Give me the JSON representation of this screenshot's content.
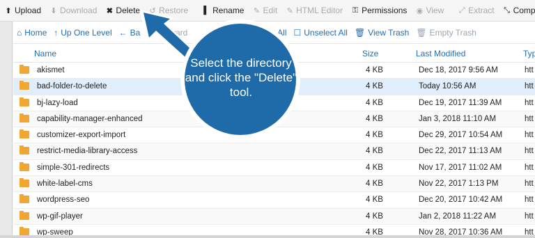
{
  "toolbar": {
    "items": [
      {
        "label": "Upload",
        "icon": "upload-icon",
        "glyph": "⭳",
        "disabled": false
      },
      {
        "label": "Download",
        "icon": "download-icon",
        "glyph": "⭳",
        "disabled": true
      },
      {
        "label": "Delete",
        "icon": "delete-icon",
        "glyph": "✖",
        "disabled": false
      },
      {
        "label": "Restore",
        "icon": "restore-icon",
        "glyph": "↺",
        "disabled": true
      },
      {
        "label": "Rename",
        "icon": "rename-icon",
        "glyph": "▌",
        "disabled": false
      },
      {
        "label": "Edit",
        "icon": "edit-icon",
        "glyph": "✎",
        "disabled": true
      },
      {
        "label": "HTML Editor",
        "icon": "html-editor-icon",
        "glyph": "✎",
        "disabled": true
      },
      {
        "label": "Permissions",
        "icon": "permissions-key-icon",
        "glyph": "⚿",
        "disabled": false
      },
      {
        "label": "View",
        "icon": "view-eye-icon",
        "glyph": "◉",
        "disabled": true
      },
      {
        "label": "Extract",
        "icon": "extract-icon",
        "glyph": "⤢",
        "disabled": true
      },
      {
        "label": "Compr",
        "icon": "compress-icon",
        "glyph": "⤡",
        "disabled": false
      }
    ]
  },
  "nav": {
    "home": "Home",
    "up_one_level": "Up One Level",
    "back": "Ba",
    "forward": "Forward",
    "select_all": "Select All",
    "unselect_all": "Unselect All",
    "view_trash": "View Trash",
    "empty_trash": "Empty Trash"
  },
  "table": {
    "headers": {
      "name": "Name",
      "size": "Size",
      "last_modified": "Last Modified",
      "type": "Typ"
    },
    "rows": [
      {
        "name": "akismet",
        "size": "4 KB",
        "modified": "Dec 18, 2017 9:56 AM",
        "type": "htt"
      },
      {
        "name": "bad-folder-to-delete",
        "size": "4 KB",
        "modified": "Today 10:56 AM",
        "type": "htt"
      },
      {
        "name": "bj-lazy-load",
        "size": "4 KB",
        "modified": "Dec 19, 2017 11:39 AM",
        "type": "htt"
      },
      {
        "name": "capability-manager-enhanced",
        "size": "4 KB",
        "modified": "Jan 3, 2018 11:10 AM",
        "type": "htt"
      },
      {
        "name": "customizer-export-import",
        "size": "4 KB",
        "modified": "Dec 29, 2017 10:54 AM",
        "type": "htt"
      },
      {
        "name": "restrict-media-library-access",
        "size": "4 KB",
        "modified": "Dec 22, 2017 11:13 AM",
        "type": "htt"
      },
      {
        "name": "simple-301-redirects",
        "size": "4 KB",
        "modified": "Nov 17, 2017 11:02 AM",
        "type": "htt"
      },
      {
        "name": "white-label-cms",
        "size": "4 KB",
        "modified": "Nov 22, 2017 1:13 PM",
        "type": "htt"
      },
      {
        "name": "wordpress-seo",
        "size": "4 KB",
        "modified": "Dec 20, 2017 10:42 AM",
        "type": "htt"
      },
      {
        "name": "wp-gif-player",
        "size": "4 KB",
        "modified": "Jan 2, 2018 11:22 AM",
        "type": "htt"
      },
      {
        "name": "wp-sweep",
        "size": "4 KB",
        "modified": "Nov 28, 2017 10:36 AM",
        "type": "htt"
      }
    ],
    "selected_row": "bad-folder-to-delete"
  },
  "callout": {
    "text": "Select the directory and click the \"Delete\" tool.",
    "color": "#1f6aa8"
  }
}
